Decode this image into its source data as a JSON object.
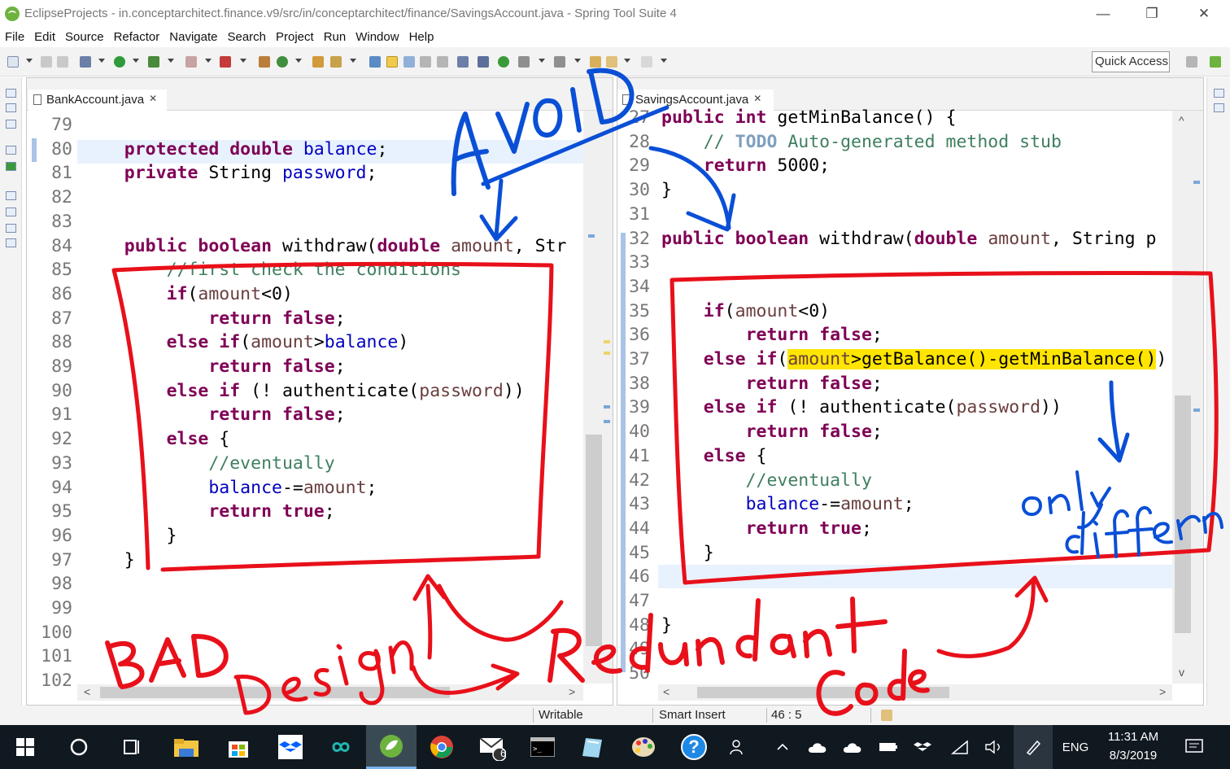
{
  "window": {
    "title": "EclipseProjects - in.conceptarchitect.finance.v9/src/in/conceptarchitect/finance/SavingsAccount.java - Spring Tool Suite 4",
    "minimize_glyph": "—",
    "restore_glyph": "❐",
    "close_glyph": "✕"
  },
  "menu": [
    "File",
    "Edit",
    "Source",
    "Refactor",
    "Navigate",
    "Search",
    "Project",
    "Run",
    "Window",
    "Help"
  ],
  "toolbar": {
    "quick_access": "Quick Access"
  },
  "left_editor": {
    "tab": "BankAccount.java",
    "tab_close": "✕",
    "scroll_left": "<",
    "scroll_right": ">",
    "lines": [
      {
        "n": "79",
        "t": ""
      },
      {
        "n": "80",
        "t": "    <span class=\"kw\">protected</span> <span class=\"kw\">double</span> <span class=\"fld\">balance</span>;"
      },
      {
        "n": "81",
        "t": "    <span class=\"kw\">private</span> String <span class=\"fld\">password</span>;"
      },
      {
        "n": "82",
        "t": ""
      },
      {
        "n": "83",
        "t": ""
      },
      {
        "n": "84",
        "t": "    <span class=\"kw\">public</span> <span class=\"kw\">boolean</span> withdraw(<span class=\"kw\">double</span> <span class=\"param\">amount</span>, Str"
      },
      {
        "n": "85",
        "t": "        <span class=\"cmt\">//first check the conditions</span>"
      },
      {
        "n": "86",
        "t": "        <span class=\"kw\">if</span>(<span class=\"param\">amount</span>&lt;0)"
      },
      {
        "n": "87",
        "t": "            <span class=\"kw\">return</span> <span class=\"kw\">false</span>;"
      },
      {
        "n": "88",
        "t": "        <span class=\"kw\">else</span> <span class=\"kw\">if</span>(<span class=\"param\">amount</span>&gt;<span class=\"fld\">balance</span>)"
      },
      {
        "n": "89",
        "t": "            <span class=\"kw\">return</span> <span class=\"kw\">false</span>;"
      },
      {
        "n": "90",
        "t": "        <span class=\"kw\">else</span> <span class=\"kw\">if</span> (! authenticate(<span class=\"param\">password</span>))"
      },
      {
        "n": "91",
        "t": "            <span class=\"kw\">return</span> <span class=\"kw\">false</span>;"
      },
      {
        "n": "92",
        "t": "        <span class=\"kw\">else</span> {"
      },
      {
        "n": "93",
        "t": "            <span class=\"cmt\">//eventually</span>"
      },
      {
        "n": "94",
        "t": "            <span class=\"fld\">balance</span>-=<span class=\"param\">amount</span>;"
      },
      {
        "n": "95",
        "t": "            <span class=\"kw\">return</span> <span class=\"kw\">true</span>;"
      },
      {
        "n": "96",
        "t": "        }"
      },
      {
        "n": "97",
        "t": "    }"
      },
      {
        "n": "98",
        "t": ""
      },
      {
        "n": "99",
        "t": ""
      },
      {
        "n": "100",
        "t": ""
      },
      {
        "n": "101",
        "t": ""
      },
      {
        "n": "102",
        "t": ""
      }
    ]
  },
  "right_editor": {
    "tab": "SavingsAccount.java",
    "tab_close": "✕",
    "scroll_left": "<",
    "scroll_right": ">",
    "scroll_up": "^",
    "scroll_down": "v",
    "lines": [
      {
        "n": "27",
        "t": "<span class=\"kw\">public</span> <span class=\"kw\">int</span> getMinBalance() {"
      },
      {
        "n": "28",
        "t": "    <span class=\"cmt\">// <span class=\"todo\">TODO</span> Auto-generated method stub</span>"
      },
      {
        "n": "29",
        "t": "    <span class=\"kw\">return</span> 5000;"
      },
      {
        "n": "30",
        "t": "}"
      },
      {
        "n": "31",
        "t": ""
      },
      {
        "n": "32",
        "t": "<span class=\"kw\">public</span> <span class=\"kw\">boolean</span> withdraw(<span class=\"kw\">double</span> <span class=\"param\">amount</span>, String p"
      },
      {
        "n": "33",
        "t": ""
      },
      {
        "n": "34",
        "t": ""
      },
      {
        "n": "35",
        "t": "    <span class=\"kw\">if</span>(<span class=\"param\">amount</span>&lt;0)"
      },
      {
        "n": "36",
        "t": "        <span class=\"kw\">return</span> <span class=\"kw\">false</span>;"
      },
      {
        "n": "37",
        "t": "    <span class=\"kw\">else</span> <span class=\"kw\">if</span>(<span class=\"hl-yellow\"><span class=\"param\">amount</span>&gt;getBalance()-getMinBalance()</span>)"
      },
      {
        "n": "38",
        "t": "        <span class=\"kw\">return</span> <span class=\"kw\">false</span>;"
      },
      {
        "n": "39",
        "t": "    <span class=\"kw\">else</span> <span class=\"kw\">if</span> (! authenticate(<span class=\"param\">password</span>))"
      },
      {
        "n": "40",
        "t": "        <span class=\"kw\">return</span> <span class=\"kw\">false</span>;"
      },
      {
        "n": "41",
        "t": "    <span class=\"kw\">else</span> {"
      },
      {
        "n": "42",
        "t": "        <span class=\"cmt\">//eventually</span>"
      },
      {
        "n": "43",
        "t": "        <span class=\"fld\">balance</span>-=<span class=\"param\">amount</span>;"
      },
      {
        "n": "44",
        "t": "        <span class=\"kw\">return</span> <span class=\"kw\">true</span>;"
      },
      {
        "n": "45",
        "t": "    }"
      },
      {
        "n": "46",
        "t": ""
      },
      {
        "n": "47",
        "t": ""
      },
      {
        "n": "48",
        "t": "}"
      },
      {
        "n": "49",
        "t": ""
      },
      {
        "n": "50",
        "t": ""
      }
    ]
  },
  "status": {
    "writable": "Writable",
    "insert_mode": "Smart Insert",
    "position": "46 : 5"
  },
  "taskbar": {
    "badge_count": "6",
    "lang": "ENG",
    "time": "11:31 AM",
    "date": "8/3/2019",
    "help_glyph": "?"
  },
  "annotations": [
    "AvoID",
    "BAD",
    "Design",
    "Redundant",
    "Code",
    "only",
    "difference"
  ],
  "colors": {
    "ink_red": "#e8101a",
    "ink_blue": "#0a4fd6",
    "highlight": "#ffe500"
  }
}
